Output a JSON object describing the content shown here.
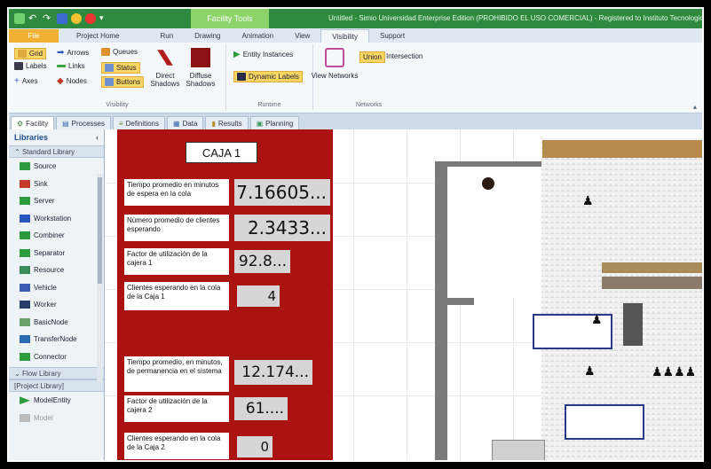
{
  "app": {
    "context_tab": "Facility Tools",
    "title": "Untitled - Simio Universidad Enterprise Edition (PROHIBIDO EL USO COMERCIAL) - Registered to Instituto Tecnologico",
    "accent": "#2d8a3e"
  },
  "ribbon_tabs": [
    "File",
    "Project Home",
    "Run",
    "Drawing",
    "Animation",
    "View",
    "Visibility",
    "Support"
  ],
  "ribbon": {
    "visibility": {
      "label": "Visibility",
      "grid": "Grid",
      "labels": "Labels",
      "axes": "Axes",
      "arrows": "Arrows",
      "links": "Links",
      "nodes": "Nodes",
      "queues": "Queues",
      "status": "Status",
      "buttons": "Buttons",
      "direct_shadows": "Direct Shadows",
      "diffuse_shadows": "Diffuse Shadows"
    },
    "runtime": {
      "label": "Runtime",
      "entity_instances": "Entity Instances",
      "dynamic_labels": "Dynamic Labels"
    },
    "networks": {
      "label": "Networks",
      "view_networks": "View Networks",
      "union": "Union",
      "intersection": "Intersection"
    }
  },
  "doc_tabs": [
    "Facility",
    "Processes",
    "Definitions",
    "Data",
    "Results",
    "Planning"
  ],
  "libraries": {
    "title": "Libraries",
    "standard": "Standard Library",
    "items": [
      "Source",
      "Sink",
      "Server",
      "Workstation",
      "Combiner",
      "Separator",
      "Resource",
      "Vehicle",
      "Worker",
      "BasicNode",
      "TransferNode",
      "Connector"
    ],
    "flow": "Flow Library",
    "project": "[Project Library]",
    "project_items": [
      "ModelEntity",
      "Model"
    ]
  },
  "dashboard": {
    "title": "CAJA 1",
    "rows": [
      {
        "label": "Tiempo promedio en minutos de espera en la cola",
        "value": "7.16605..."
      },
      {
        "label": "Número promedio de clientes esperando",
        "value": "2.3433..."
      },
      {
        "label": "Factor de utilización de la cajera 1",
        "value": "92.8..."
      },
      {
        "label": "Clientes esperando en la cola de la Caja 1",
        "value": "4"
      },
      {
        "label": "Tiempo promedio, en minutos, de permanencia en el sistema",
        "value": "12.174..."
      },
      {
        "label": "Factor de utilización de la cajera 2",
        "value": "61...."
      },
      {
        "label": "Clientes esperando en la cola de la Caja 2",
        "value": "0"
      }
    ],
    "panel_color": "#ab1313"
  }
}
